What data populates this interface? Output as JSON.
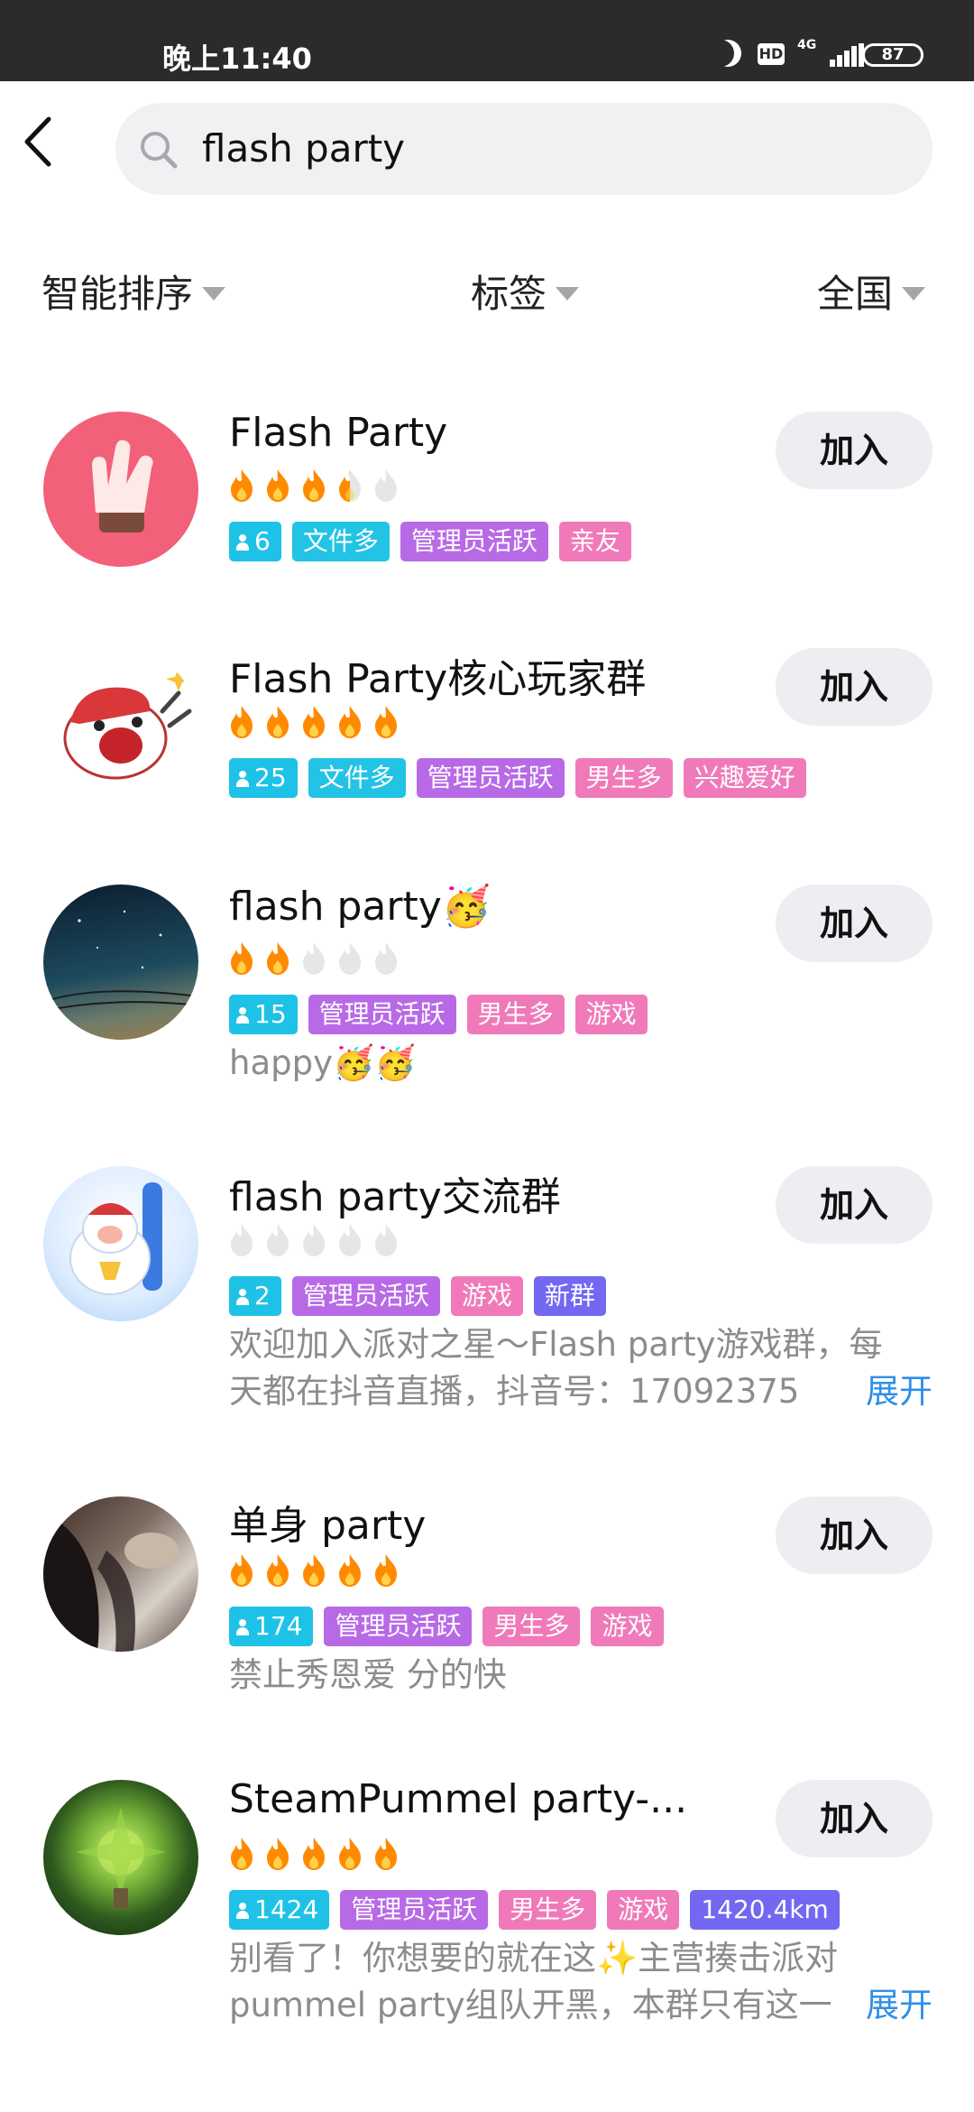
{
  "status_bar": {
    "time": "晚上11:40",
    "network": "4G",
    "battery": "87"
  },
  "search": {
    "query": "flash party"
  },
  "filters": [
    {
      "label": "智能排序"
    },
    {
      "label": "标签"
    },
    {
      "label": "全国"
    }
  ],
  "join_label": "加入",
  "groups": [
    {
      "title": "Flash Party",
      "heat": 3.5,
      "member_count": "6",
      "tags": [
        "文件多",
        "管理员活跃",
        "亲友"
      ],
      "description": ""
    },
    {
      "title": "Flash Party核心玩家群",
      "heat": 5,
      "member_count": "25",
      "tags": [
        "文件多",
        "管理员活跃",
        "男生多",
        "兴趣爱好"
      ],
      "description": ""
    },
    {
      "title": "flash party🥳",
      "heat": 2,
      "member_count": "15",
      "tags": [
        "管理员活跃",
        "男生多",
        "游戏"
      ],
      "description": "happy🥳🥳"
    },
    {
      "title": "flash party交流群",
      "heat": 0,
      "member_count": "2",
      "tags": [
        "管理员活跃",
        "游戏",
        "新群"
      ],
      "description_line1": "欢迎加入派对之星～Flash party游戏群，每",
      "description_line2": "天都在抖音直播，抖音号：17092375",
      "expand": "展开"
    },
    {
      "title": "单身 party",
      "heat": 5,
      "member_count": "174",
      "tags": [
        "管理员活跃",
        "男生多",
        "游戏"
      ],
      "description": "禁止秀恩爱  分的快"
    },
    {
      "title": "SteamPummel party-...",
      "heat": 5,
      "member_count": "1424",
      "tags": [
        "管理员活跃",
        "男生多",
        "游戏",
        "1420.4km"
      ],
      "description_line1": "别看了！你想要的就在这✨主营揍击派对",
      "description_line2": "pummel party组队开黑，本群只有这一",
      "expand": "展开"
    }
  ],
  "colors": {
    "flame_hot": "#ff8a00",
    "flame_cold": "#e6e6e6",
    "tag_blue": "#23c3e5",
    "tag_purple": "#b86ae6",
    "tag_pink": "#f07ab9",
    "tag_indigo": "#7268f2",
    "expand_link": "#2f8fe8"
  }
}
